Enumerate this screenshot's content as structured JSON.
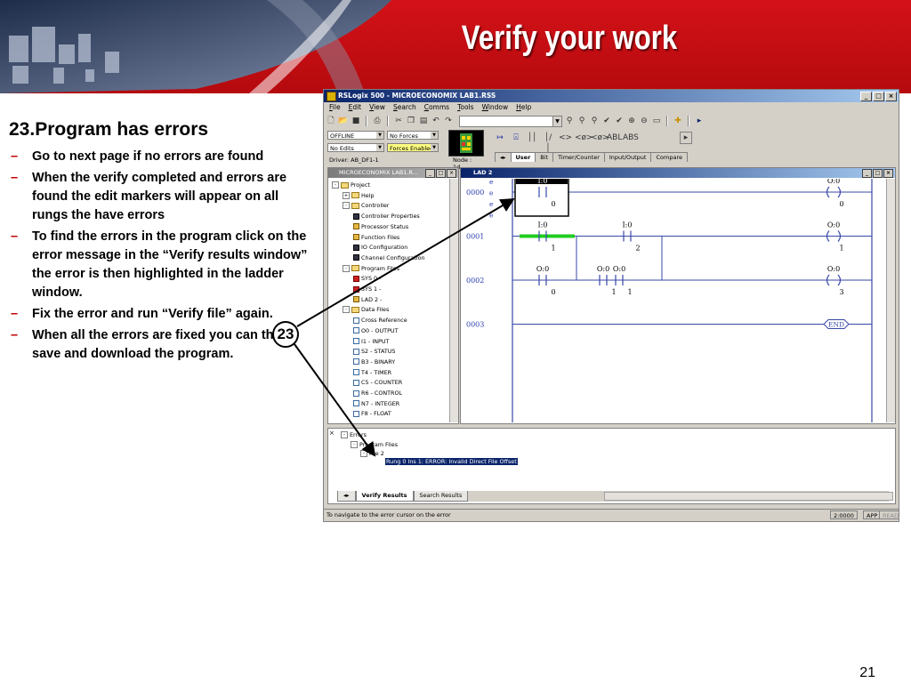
{
  "slide": {
    "title": "Verify your work",
    "page_number": "21",
    "heading": "23.Program has errors",
    "bullets": [
      "Go to next page if no errors are found",
      "When the verify completed and errors are found the edit markers will appear on all rungs the have errors",
      "To find the errors in the program click on the error message in the “Verify results window” the error is then highlighted in the ladder window.",
      "Fix the error and run “Verify file” again.",
      "When all the errors are fixed you can then save and download the program."
    ],
    "callout": "23",
    "colors": {
      "banner_red": "#c20e12",
      "bullet_dash": "#c00000"
    }
  },
  "app": {
    "title": "RSLogix 500 - MICROECONOMIX LAB1.RSS",
    "window_buttons": [
      "_",
      "×",
      "□"
    ],
    "menu": [
      "File",
      "Edit",
      "View",
      "Search",
      "Comms",
      "Tools",
      "Window",
      "Help"
    ],
    "toolbar_icons": [
      "new-icon",
      "open-icon",
      "save-icon",
      "print-icon",
      "cut-icon",
      "copy-icon",
      "paste-icon",
      "undo-icon",
      "redo-icon"
    ],
    "status": {
      "mode": "OFFLINE",
      "forces": "No Forces",
      "edits": "No Edits",
      "forces_enabled": "Forces Enabled",
      "driver": "Driver: AB_DF1-1",
      "node": "Node : 1d"
    },
    "instr_tabs": [
      "User",
      "Bit",
      "Timer/Counter",
      "Input/Output",
      "Compare"
    ],
    "instr_icons": [
      "↦",
      "⍓",
      "││",
      "│/│",
      "<>",
      "<ø>",
      "<ø>",
      "ABL",
      "ABS"
    ]
  },
  "project": {
    "title": "MICROECONOMIX LAB1.R...",
    "tree": [
      {
        "label": "Project",
        "depth": 0,
        "icon": "folder",
        "pm": "-"
      },
      {
        "label": "Help",
        "depth": 1,
        "icon": "folder",
        "pm": "+"
      },
      {
        "label": "Controller",
        "depth": 1,
        "icon": "folder",
        "pm": "-"
      },
      {
        "label": "Controller Properties",
        "depth": 2,
        "icon": "person"
      },
      {
        "label": "Processor Status",
        "depth": 2,
        "icon": "misc"
      },
      {
        "label": "Function Files",
        "depth": 2,
        "icon": "misc"
      },
      {
        "label": "IO Configuration",
        "depth": 2,
        "icon": "person"
      },
      {
        "label": "Channel Configuration",
        "depth": 2,
        "icon": "person"
      },
      {
        "label": "Program Files",
        "depth": 1,
        "icon": "folder",
        "pm": "-"
      },
      {
        "label": "SYS 0 -",
        "depth": 2,
        "icon": "ladder"
      },
      {
        "label": "SYS 1 -",
        "depth": 2,
        "icon": "ladder"
      },
      {
        "label": "LAD 2 -",
        "depth": 2,
        "icon": "misc"
      },
      {
        "label": "Data Files",
        "depth": 1,
        "icon": "folder",
        "pm": "-"
      },
      {
        "label": "Cross Reference",
        "depth": 2,
        "icon": "file"
      },
      {
        "label": "O0 - OUTPUT",
        "depth": 2,
        "icon": "file"
      },
      {
        "label": "I1 - INPUT",
        "depth": 2,
        "icon": "file"
      },
      {
        "label": "S2 - STATUS",
        "depth": 2,
        "icon": "file"
      },
      {
        "label": "B3 - BINARY",
        "depth": 2,
        "icon": "file"
      },
      {
        "label": "T4 - TIMER",
        "depth": 2,
        "icon": "file"
      },
      {
        "label": "C5 - COUNTER",
        "depth": 2,
        "icon": "file"
      },
      {
        "label": "R6 - CONTROL",
        "depth": 2,
        "icon": "file"
      },
      {
        "label": "N7 - INTEGER",
        "depth": 2,
        "icon": "file"
      },
      {
        "label": "F8 - FLOAT",
        "depth": 2,
        "icon": "file"
      }
    ]
  },
  "ladder": {
    "title": "LAD 2",
    "rungs": [
      {
        "number": "0000",
        "edit_markers": [
          "e",
          "e",
          "e",
          "e"
        ],
        "elements": [
          {
            "kind": "xic",
            "addr": "I:0",
            "bit": "0",
            "selected": true
          },
          {
            "kind": "ote",
            "addr": "O:0",
            "bit": "0"
          }
        ]
      },
      {
        "number": "0001",
        "elements": [
          {
            "kind": "xic",
            "addr": "I:0",
            "bit": "1",
            "energized": true
          },
          {
            "kind": "xic",
            "addr": "I:0",
            "bit": "2"
          },
          {
            "kind": "ote",
            "addr": "O:0",
            "bit": "1"
          }
        ],
        "branch": {
          "kind": "xic",
          "addr": "O:0",
          "bit": "1"
        }
      },
      {
        "number": "0002",
        "elements": [
          {
            "kind": "xic",
            "addr": "O:0",
            "bit": "0"
          },
          {
            "kind": "xic",
            "addr": "O:0",
            "bit": "1"
          },
          {
            "kind": "ote",
            "addr": "O:0",
            "bit": "3"
          }
        ]
      },
      {
        "number": "0003",
        "elements": [
          {
            "kind": "end",
            "label": "END"
          }
        ]
      }
    ],
    "colors": {
      "rung": "#3848a8",
      "rung_number": "#2a3ab0",
      "energized": "#22cc22",
      "selected_bg": "#000000"
    }
  },
  "errors": {
    "tree": [
      {
        "label": "Errors",
        "depth": 0,
        "pm": "-"
      },
      {
        "label": "Program Files",
        "depth": 1,
        "pm": "-"
      },
      {
        "label": "File 2",
        "depth": 2,
        "pm": "-"
      }
    ],
    "message": "Rung 0 Ins 1: ERROR: Invalid Direct File Offset",
    "tabs": [
      "Verify Results",
      "Search Results"
    ]
  },
  "statusbar": {
    "message": "To navigate to the error cursor on the error",
    "position": "2:0000",
    "app": "APP",
    "read": "READ"
  }
}
